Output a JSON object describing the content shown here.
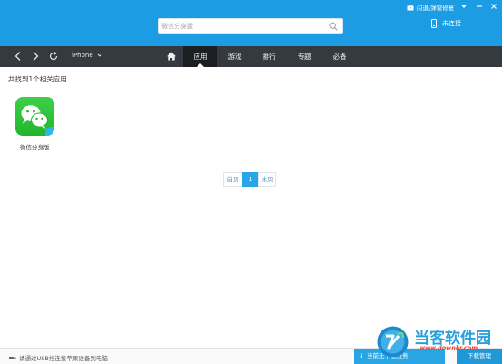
{
  "header": {
    "search_placeholder": "微信分身版",
    "repair_label": "闪退/弹窗修复",
    "connection_status": "未连接"
  },
  "nav": {
    "device_label": "iPhone",
    "tabs": [
      {
        "label": "应用",
        "active": true
      },
      {
        "label": "游戏",
        "active": false
      },
      {
        "label": "排行",
        "active": false
      },
      {
        "label": "专题",
        "active": false
      },
      {
        "label": "必备",
        "active": false
      }
    ]
  },
  "content": {
    "result_count": "共找到1个相关应用",
    "apps": [
      {
        "name": "微信分身版",
        "icon": "wechat-icon"
      }
    ],
    "pagination": {
      "first_label": "首页",
      "current": "1",
      "last_label": "末页"
    }
  },
  "footer": {
    "usb_hint": "请通过USB线连接苹果设备到电脑",
    "download_status": "当前无下载任务",
    "download_manage": "下载管理"
  },
  "watermark": {
    "name": "当客软件园",
    "url": "www.downkr.com"
  },
  "colors": {
    "header_blue": "#1c9ce3",
    "nav_dark": "#343a3f",
    "nav_active": "#1b1f22",
    "accent": "#26a6e8",
    "wechat_green": "#2ec338"
  }
}
